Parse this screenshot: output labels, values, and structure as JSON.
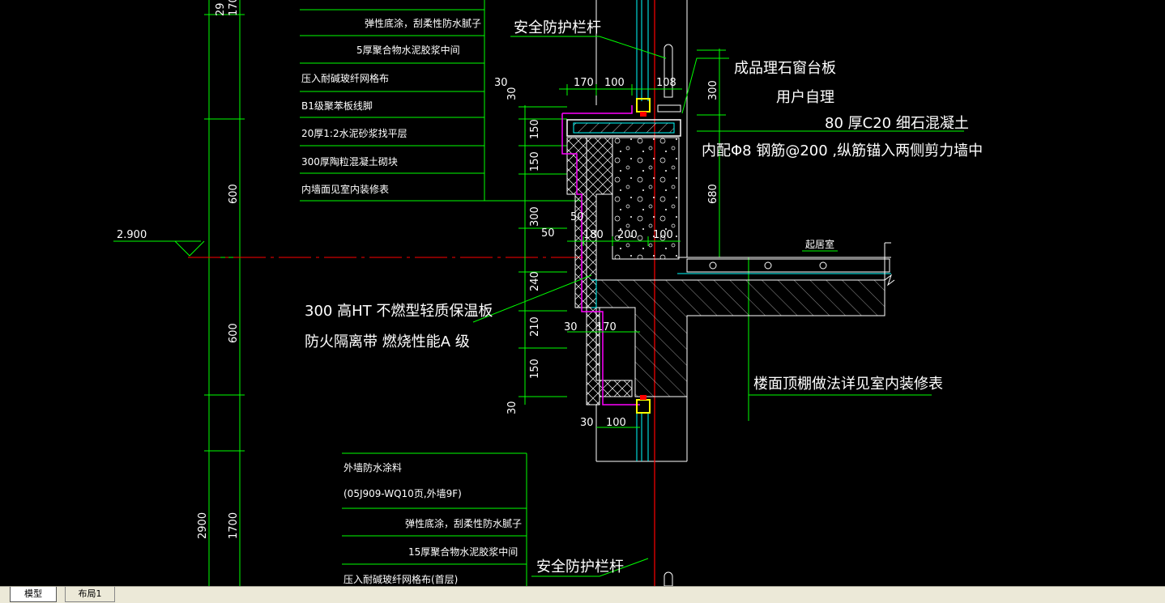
{
  "drawing": {
    "upper_layers": [
      "弹性底涂，刮柔性防水腻子",
      "5厚聚合物水泥胶浆中间",
      "压入耐碱玻纤网格布",
      "B1级聚苯板线脚",
      "20厚1:2水泥砂浆找平层",
      "300厚陶粒混凝土砌块",
      "内墙面见室内装修表"
    ],
    "lower_layers": [
      "外墙防水涂料",
      "(05J909-WQ10页,外墙9F)",
      "弹性底涂，刮柔性防水腻子",
      "15厚聚合物水泥胶浆中间",
      "压入耐碱玻纤网格布(首层)"
    ],
    "railing_top": "安全防护栏杆",
    "railing_bottom": "安全防护栏杆",
    "sill_label_1": "成品理石窗台板",
    "sill_label_2": "用户自理",
    "concrete_label": "80  厚C20   细石混凝土",
    "rebar_label": "内配Φ8  钢筋@200   ,纵筋锚入两侧剪力墙中",
    "insulation_label_1": "300   高HT  不燃型轻质保温板",
    "insulation_label_2": "防火隔离带 燃烧性能A  级",
    "ceiling_label": "楼面顶棚做法详见室内装修表",
    "room_label": "起居室",
    "elevation": "2.900",
    "dims": {
      "left_top_a": "29",
      "left_top_b": "170",
      "left_mid_a": "600",
      "left_mid_b": "600",
      "left_bot_a": "2900",
      "left_bot_b": "1700",
      "top_30": "30",
      "top_170": "170",
      "top_100": "100",
      "top_108": "108",
      "v_30a": "30",
      "v_150a": "150",
      "v_150b": "150",
      "v_300": "300",
      "v_240": "240",
      "v_210": "210",
      "v_150c": "150",
      "v_30b": "30",
      "d_50a": "50",
      "d_50b": "50",
      "d_180": "180",
      "d_200": "200",
      "d_100": "100",
      "d_30": "30",
      "d_170": "170",
      "b_30": "30",
      "b_100": "100",
      "r_300": "300",
      "r_680": "680"
    }
  },
  "tabs": {
    "model": "模型",
    "layout1": "布局1"
  },
  "colors": {
    "line_green": "#00ff00",
    "text_white": "#ffffff",
    "red_axis": "#ff0000",
    "magenta": "#ff00ff",
    "cyan": "#00ffff",
    "yellow": "#ffff00"
  }
}
